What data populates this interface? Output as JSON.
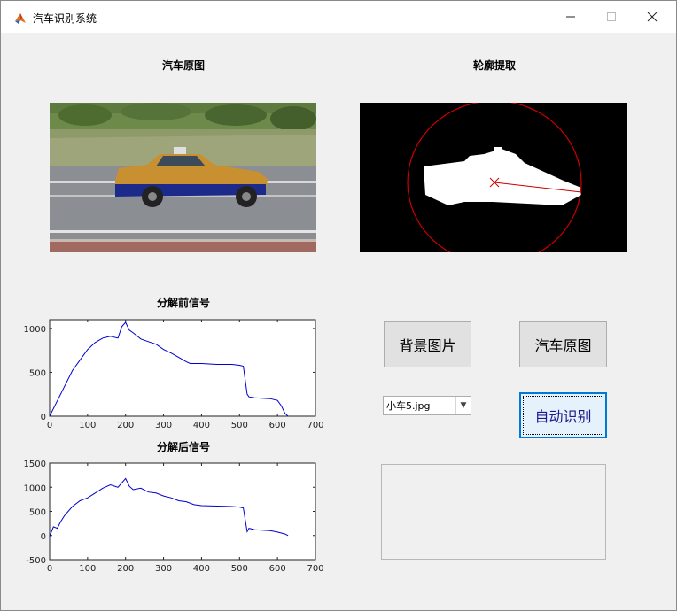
{
  "window": {
    "title": "汽车识别系统"
  },
  "labels": {
    "original": "汽车原图",
    "contour": "轮廓提取",
    "before": "分解前信号",
    "after": "分解后信号"
  },
  "buttons": {
    "background": "背景图片",
    "car_original": "汽车原图",
    "auto_recognize": "自动识别"
  },
  "dropdown": {
    "selected": "小车5.jpg"
  },
  "result_text": "",
  "chart_data": [
    {
      "type": "line",
      "title": "分解前信号",
      "xlim": [
        0,
        700
      ],
      "ylim": [
        0,
        1100
      ],
      "xticks": [
        "0",
        "100",
        "200",
        "300",
        "400",
        "500",
        "600",
        "700"
      ],
      "yticks": [
        "0",
        "500",
        "1000"
      ],
      "series": [
        {
          "color": "#0000cc",
          "x": [
            0,
            30,
            60,
            80,
            100,
            120,
            140,
            160,
            180,
            190,
            200,
            210,
            220,
            240,
            260,
            280,
            300,
            320,
            340,
            360,
            370,
            400,
            440,
            480,
            500,
            510,
            520,
            525,
            540,
            580,
            600,
            610,
            620,
            628
          ],
          "y": [
            0,
            260,
            520,
            640,
            760,
            840,
            890,
            910,
            890,
            1020,
            1070,
            980,
            950,
            880,
            850,
            820,
            760,
            720,
            670,
            620,
            600,
            600,
            590,
            590,
            580,
            570,
            250,
            220,
            210,
            200,
            180,
            120,
            30,
            0
          ]
        }
      ]
    },
    {
      "type": "line",
      "title": "分解后信号",
      "xlim": [
        0,
        700
      ],
      "ylim": [
        -500,
        1500
      ],
      "xticks": [
        "0",
        "100",
        "200",
        "300",
        "400",
        "500",
        "600",
        "700"
      ],
      "yticks": [
        "-500",
        "0",
        "500",
        "1000",
        "1500"
      ],
      "series": [
        {
          "color": "#0000cc",
          "x": [
            0,
            10,
            20,
            30,
            40,
            60,
            80,
            100,
            120,
            140,
            160,
            180,
            200,
            210,
            220,
            240,
            260,
            280,
            300,
            320,
            340,
            360,
            380,
            400,
            440,
            480,
            500,
            510,
            520,
            525,
            540,
            580,
            600,
            610,
            620,
            628
          ],
          "y": [
            -20,
            180,
            150,
            300,
            420,
            600,
            720,
            780,
            880,
            980,
            1050,
            1000,
            1180,
            1020,
            950,
            980,
            900,
            880,
            820,
            780,
            720,
            700,
            640,
            620,
            610,
            600,
            590,
            570,
            80,
            150,
            120,
            100,
            70,
            50,
            30,
            0
          ]
        }
      ]
    }
  ]
}
